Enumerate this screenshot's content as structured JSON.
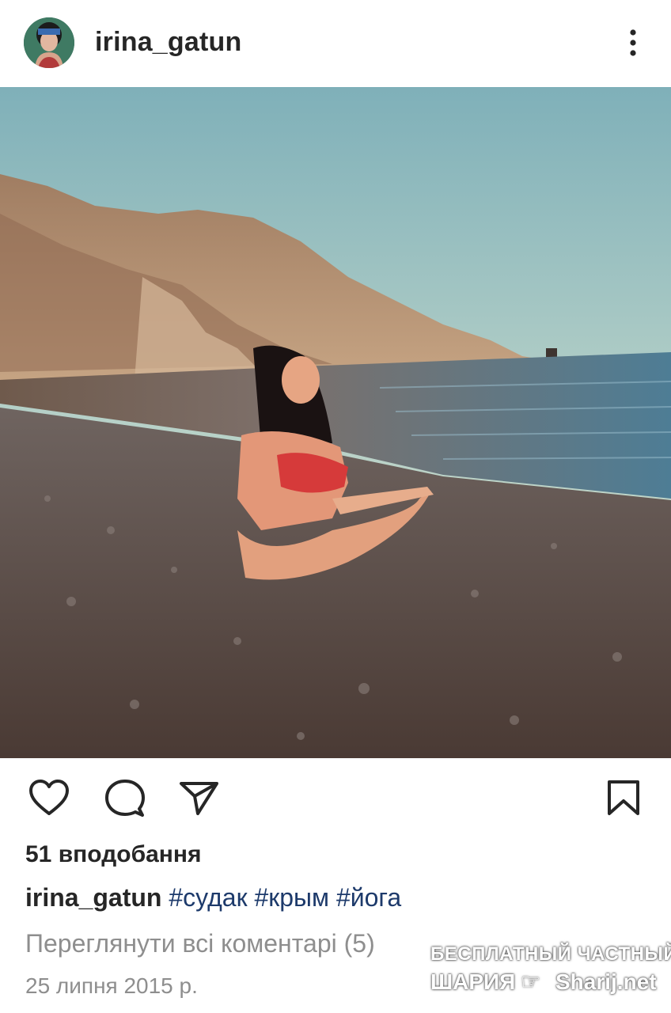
{
  "header": {
    "username": "irina_gatun",
    "avatar_icon": "profile-avatar",
    "more_icon": "more-vertical-icon"
  },
  "post": {
    "image_icon": "beach-yoga-photo"
  },
  "actions": {
    "like_icon": "heart-icon",
    "comment_icon": "comment-bubble-icon",
    "share_icon": "send-icon",
    "save_icon": "bookmark-icon"
  },
  "details": {
    "likes": "51 вподобання",
    "caption_user": "irina_gatun",
    "hashtags": [
      "#судак",
      "#крым",
      "#йога"
    ],
    "view_comments": "Переглянути всі коментарі (5)",
    "date": "25 липня 2015 р."
  },
  "watermark": {
    "line1": "БЕСПЛАТНЫЙ ЧАСТНЫЙ",
    "line2": "ШАРИЯ",
    "site": "Sharij.net"
  },
  "colors": {
    "text": "#262626",
    "muted": "#8e8e8e",
    "hashtag": "#1d3a6b"
  }
}
